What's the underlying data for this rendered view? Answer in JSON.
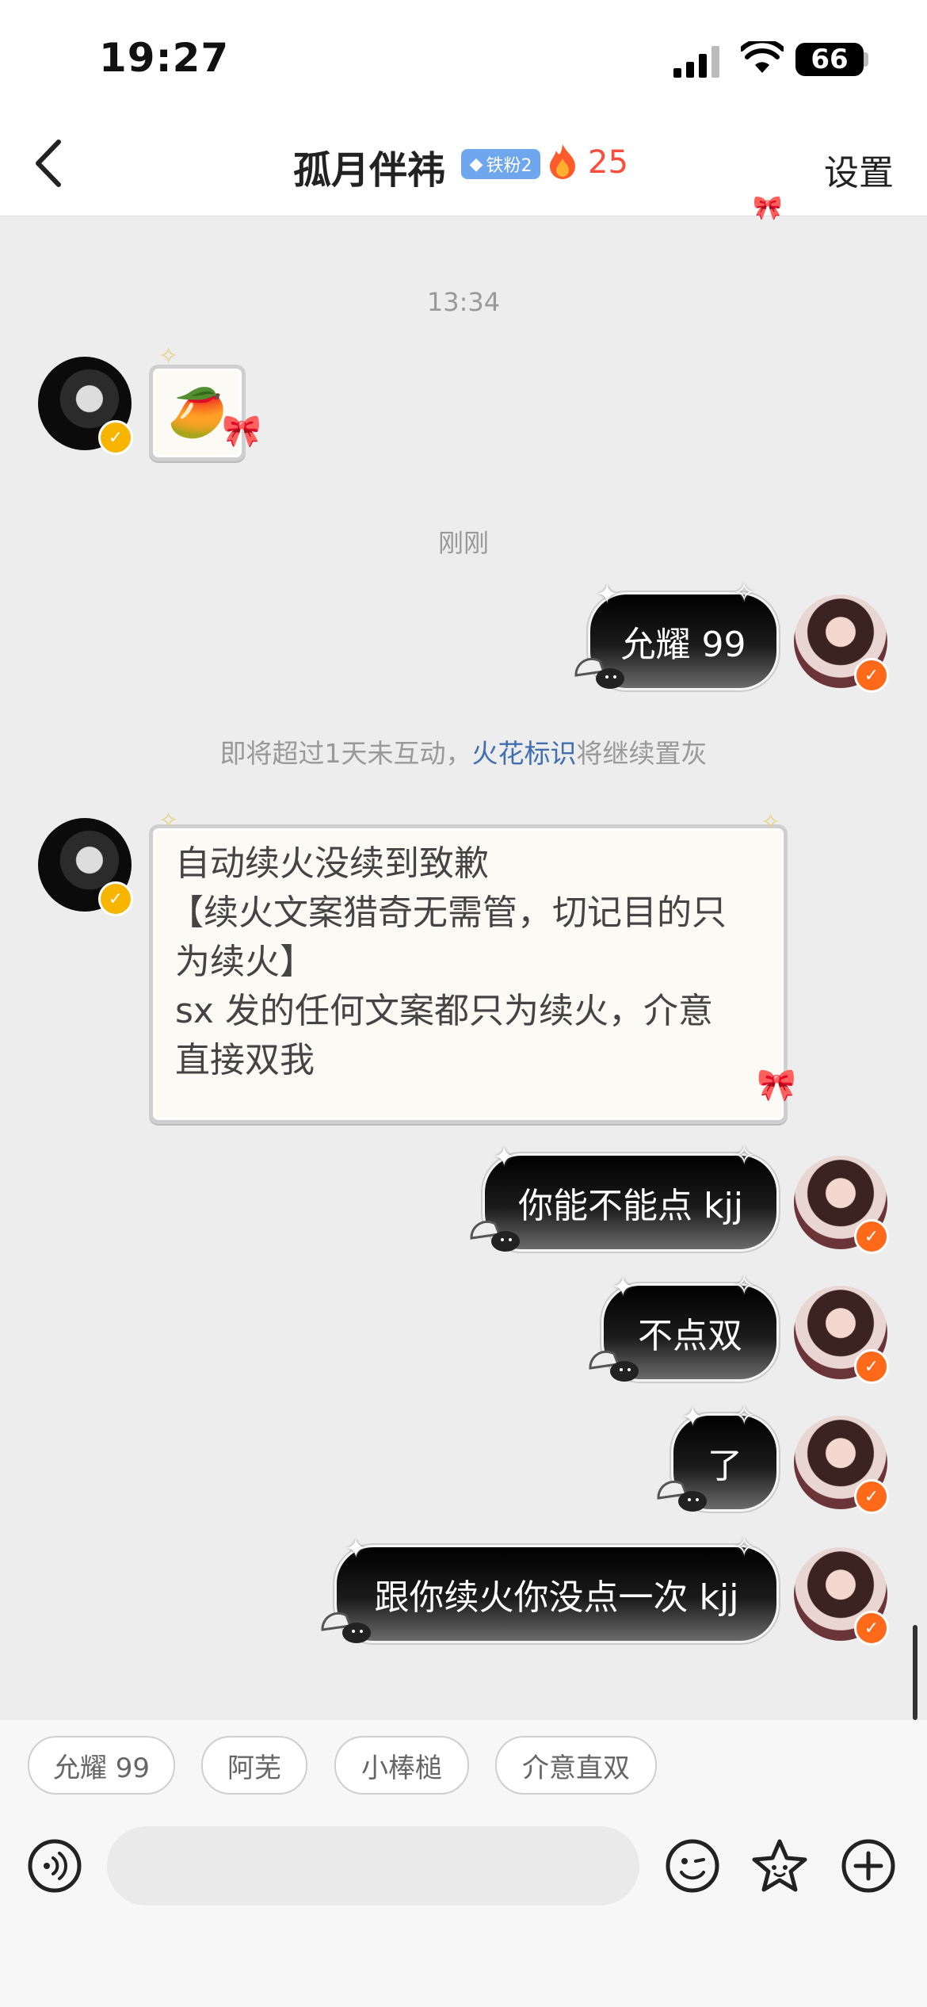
{
  "status_bar": {
    "time": "19:27",
    "battery": "66"
  },
  "nav": {
    "title": "孤月伴祎",
    "fan_badge": "铁粉2",
    "streak": "25",
    "settings": "设置"
  },
  "messages": {
    "time_1": "13:34",
    "time_2": "刚刚",
    "m_mango": {
      "text": "🥭"
    },
    "m_yunyao": "允耀 99",
    "notice_prefix": "即将超过1天未互动，",
    "notice_link": "火花标识",
    "notice_suffix": "将继续置灰",
    "m_long": {
      "line1": "自动续火没续到致歉",
      "line2": "【续火文案猎奇无需管，切记目的只",
      "line3": "为续火】",
      "line4": "sx 发的任何文案都只为续火，介意",
      "line5": "直接双我"
    },
    "m_kjj": "你能不能点 kjj",
    "m_budian": "不点双",
    "m_le": "了",
    "m_genni": "跟你续火你没点一次 kjj"
  },
  "quick_replies": [
    "允耀 99",
    "阿芜",
    "小棒槌",
    "介意直双"
  ],
  "input": {
    "placeholder": ""
  },
  "colors": {
    "accent_blue": "#3f6fb1",
    "streak_red": "#ff4d3d",
    "badge_blue": "#6fa7ee"
  }
}
